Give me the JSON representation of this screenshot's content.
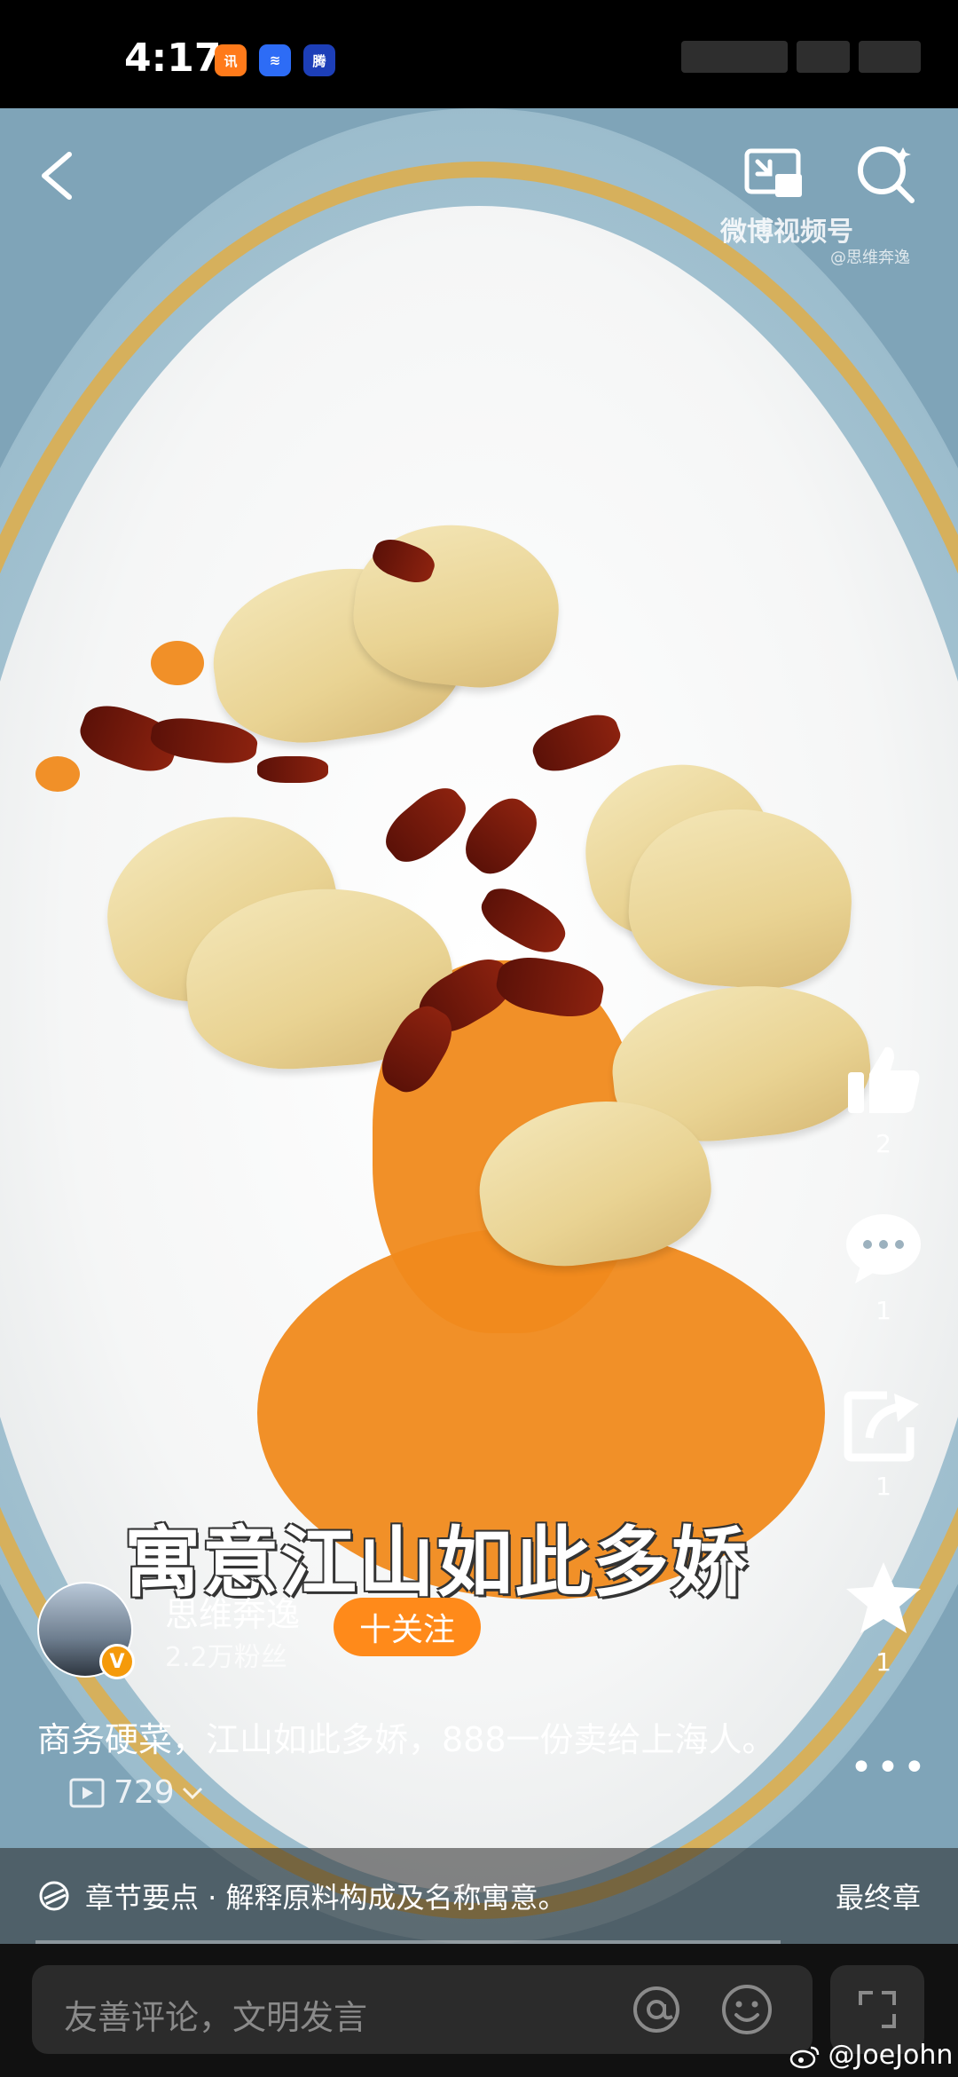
{
  "status": {
    "time": "4:17",
    "apps": [
      "腾讯",
      "声",
      "腾"
    ]
  },
  "header": {
    "watermark": "微博视频号",
    "watermark_sub": "@思维奔逸"
  },
  "video": {
    "caption": "寓意江山如此多娇"
  },
  "actions": {
    "like_count": "2",
    "comment_count": "1",
    "share_count": "1",
    "favorite_count": "1"
  },
  "author": {
    "name": "思维奔逸",
    "fans": "2.2万粉丝",
    "follow_label": "十关注",
    "verified_mark": "V"
  },
  "post": {
    "description": "商务硬菜，江山如此多娇，888一份卖给上海人。",
    "play_count": "729"
  },
  "chapter": {
    "text": "章节要点 · 解释原料构成及名称寓意。",
    "final_label": "最终章"
  },
  "comment": {
    "placeholder": "友善评论，文明发言"
  },
  "footer": {
    "weibo_handle": "@JoeJohn"
  },
  "colors": {
    "accent": "#ff8a1a",
    "verified": "#f59a0a",
    "sauce": "#f08a1c"
  }
}
